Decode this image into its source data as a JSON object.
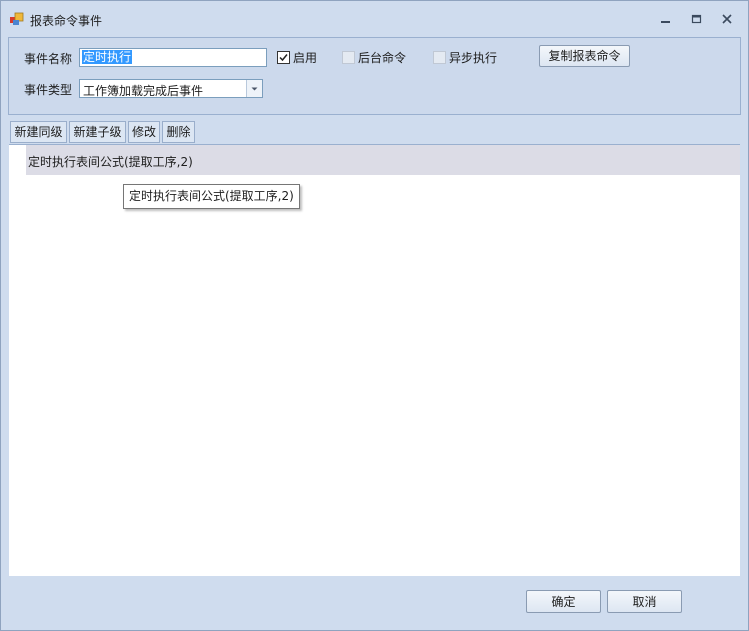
{
  "window": {
    "title": "报表命令事件"
  },
  "form": {
    "event_name_label": "事件名称",
    "event_name_value": "定时执行",
    "enabled_label": "启用",
    "enabled_checked": true,
    "background_label": "后台命令",
    "async_label": "异步执行",
    "copy_button": "复制报表命令",
    "event_type_label": "事件类型",
    "event_type_value": "工作簿加载完成后事件"
  },
  "toolbar": {
    "new_sibling": "新建同级",
    "new_child": "新建子级",
    "edit": "修改",
    "delete": "删除"
  },
  "tree": {
    "items": [
      {
        "label": "定时执行表间公式(提取工序,2)"
      }
    ],
    "tooltip": "定时执行表间公式(提取工序,2)"
  },
  "footer": {
    "ok": "确定",
    "cancel": "取消"
  }
}
